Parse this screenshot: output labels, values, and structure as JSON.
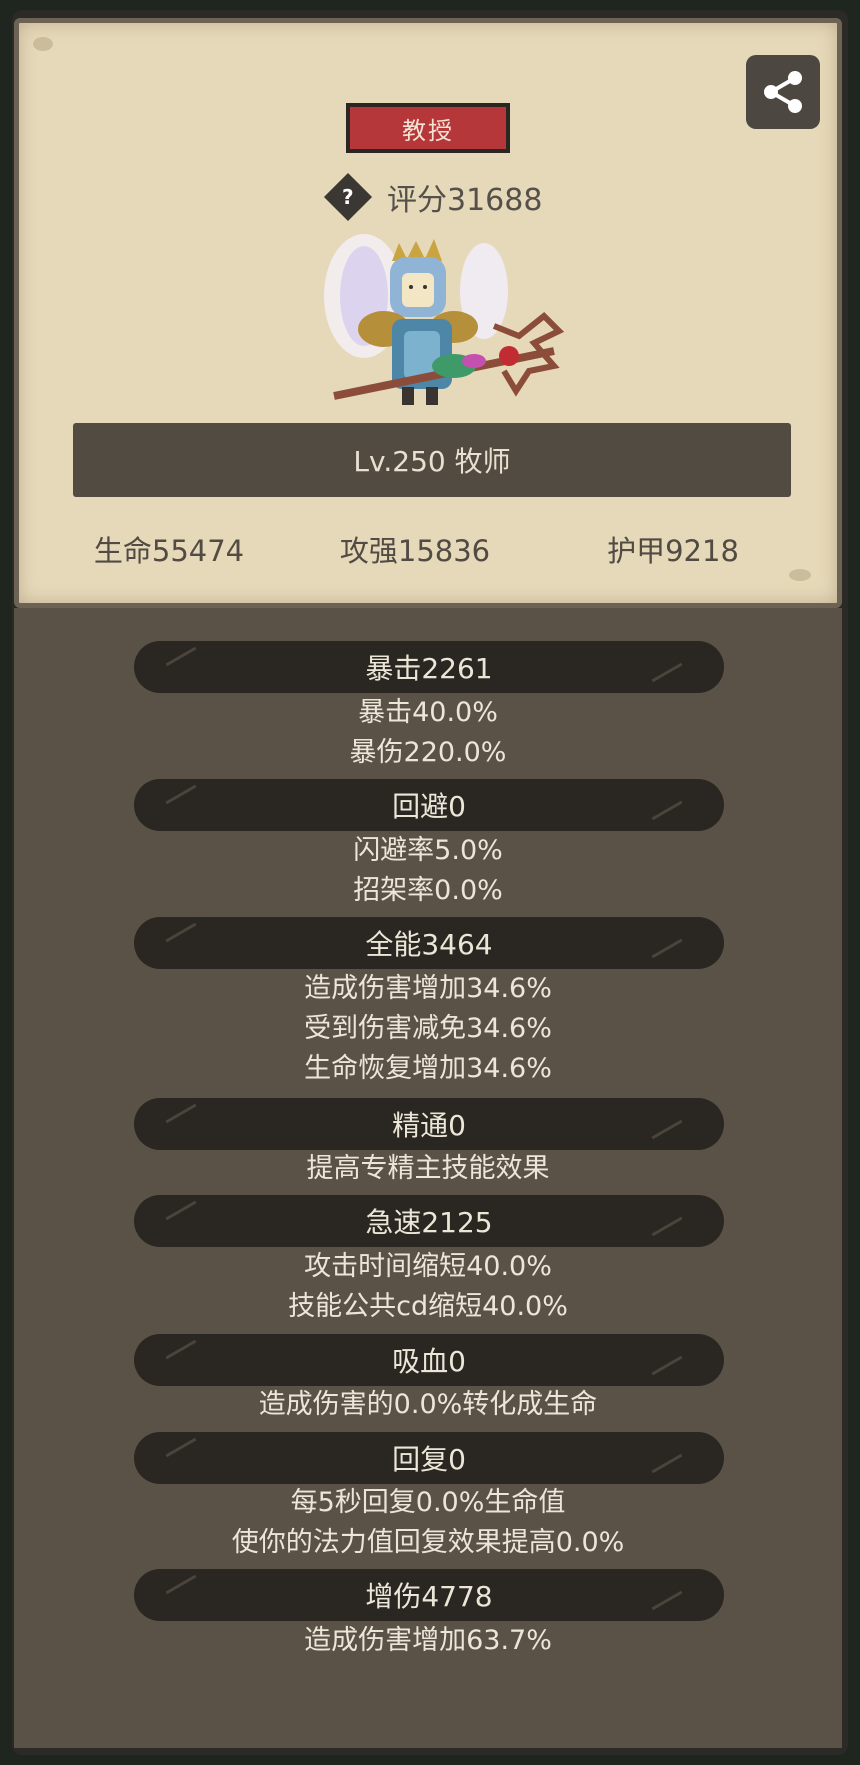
{
  "rank_badge": "教授",
  "score": "评分31688",
  "level_class": "Lv.250 牧师",
  "main_stats": {
    "hp": "生命55474",
    "attack": "攻强15836",
    "armor": "护甲9218"
  },
  "stats": {
    "crit": {
      "header": "暴击2261",
      "lines": [
        "暴击40.0%",
        "暴伤220.0%"
      ]
    },
    "dodge": {
      "header": "回避0",
      "lines": [
        "闪避率5.0%",
        "招架率0.0%"
      ]
    },
    "versatility": {
      "header": "全能3464",
      "lines": [
        "造成伤害增加34.6%",
        "受到伤害减免34.6%",
        "生命恢复增加34.6%"
      ]
    },
    "mastery": {
      "header": "精通0",
      "lines": [
        "提高专精主技能效果"
      ]
    },
    "haste": {
      "header": "急速2125",
      "lines": [
        "攻击时间缩短40.0%",
        "技能公共cd缩短40.0%"
      ]
    },
    "leech": {
      "header": "吸血0",
      "lines": [
        "造成伤害的0.0%转化成生命"
      ]
    },
    "regen": {
      "header": "回复0",
      "lines": [
        "每5秒回复0.0%生命值",
        "使你的法力值回复效果提高0.0%"
      ]
    },
    "damage_bonus": {
      "header": "增伤4778",
      "lines": [
        "造成伤害增加63.7%"
      ]
    }
  },
  "icons": {
    "share": "share-icon",
    "help": "help-icon",
    "hero": "hero-portrait"
  },
  "colors": {
    "badge": "#b5373a",
    "parchment": "#e6d9b9",
    "panel": "#5a5246",
    "header_bar": "#2a2621"
  }
}
